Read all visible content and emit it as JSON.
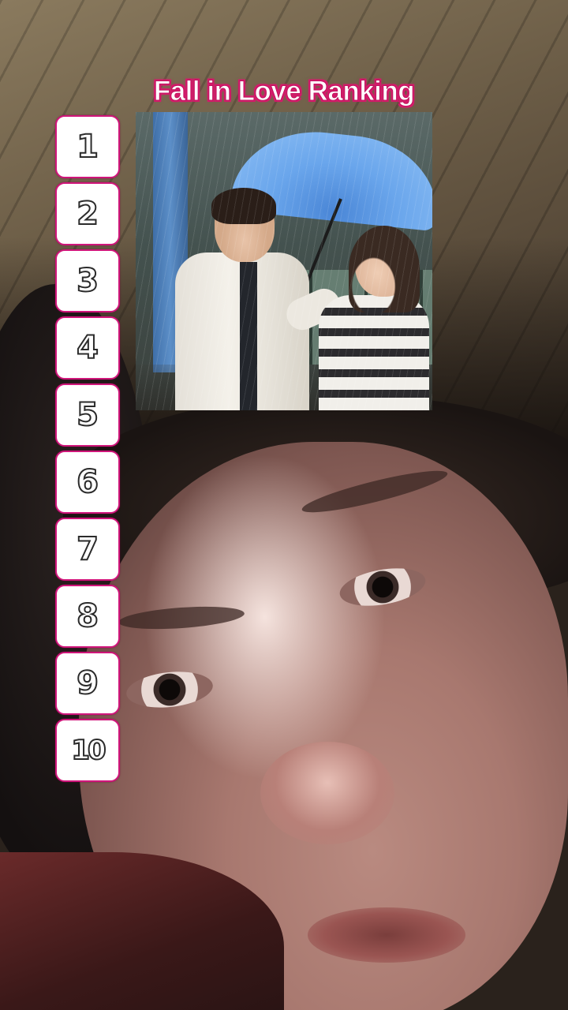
{
  "overlay": {
    "title": "Fall in Love Ranking",
    "ranking_slots": [
      "1",
      "2",
      "3",
      "4",
      "5",
      "6",
      "7",
      "8",
      "9",
      "10"
    ]
  },
  "candidate_image": {
    "description_icon": "drama-still-image"
  },
  "colors": {
    "title_outline": "#d41a6a",
    "slot_border": "#d0157a",
    "slot_fill": "#ffffff"
  }
}
